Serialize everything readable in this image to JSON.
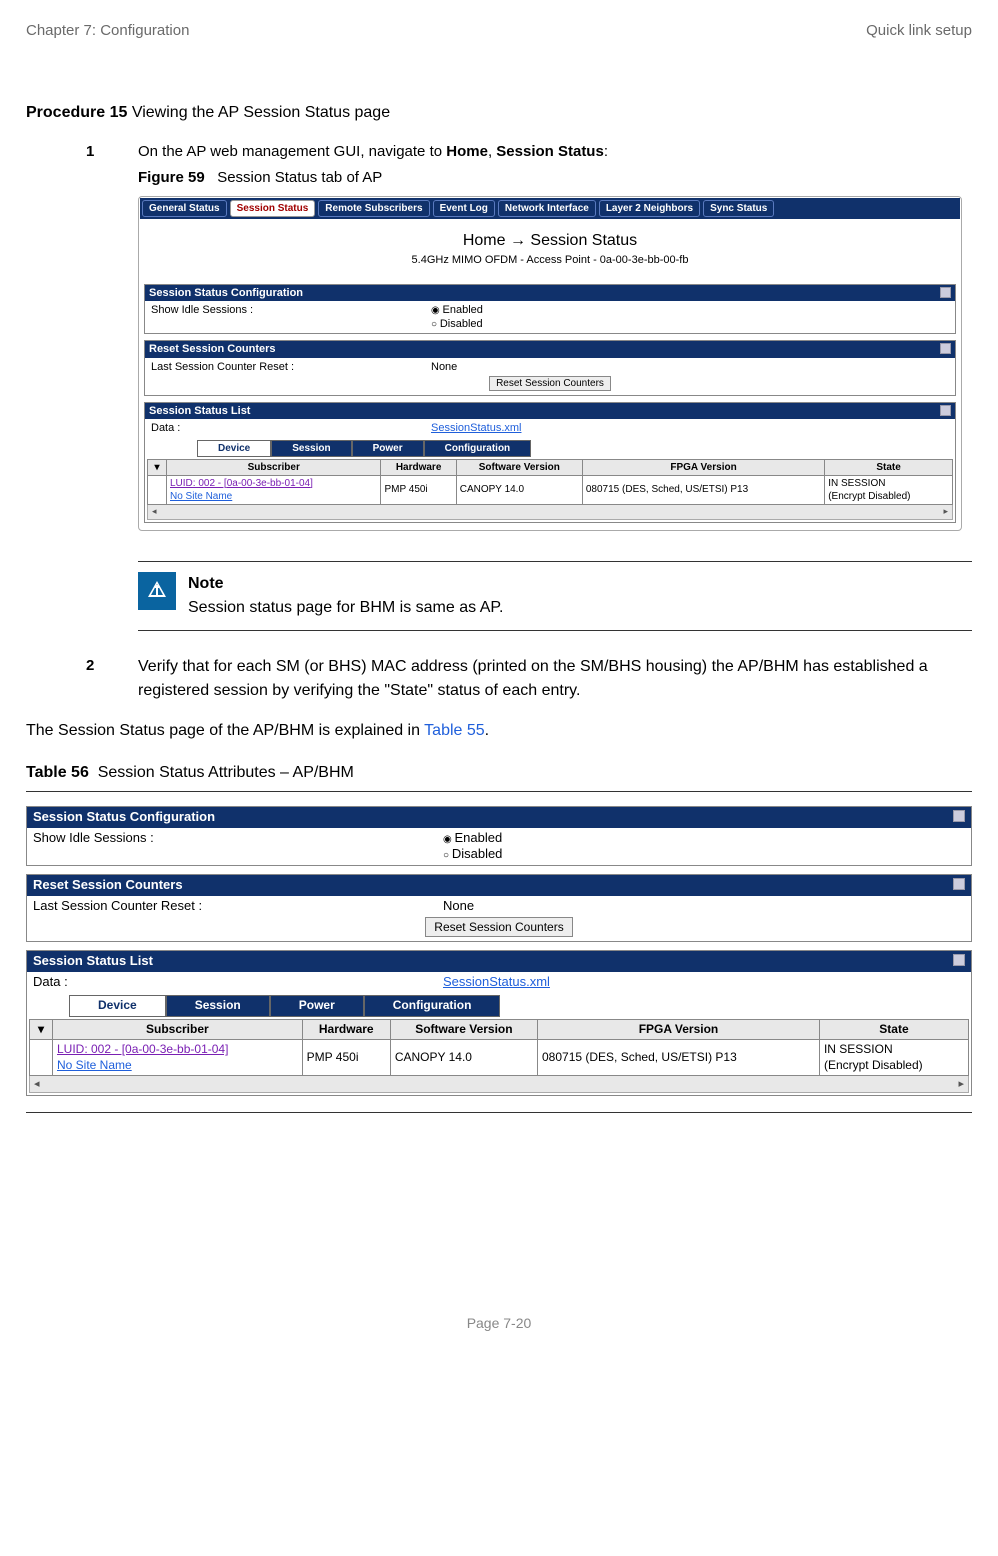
{
  "header": {
    "left": "Chapter 7:  Configuration",
    "right": "Quick link setup"
  },
  "procedure": {
    "num": "Procedure 15",
    "title": "Viewing the AP Session Status page"
  },
  "step1": {
    "num": "1",
    "text_a": "On the AP web management GUI, navigate to ",
    "home": "Home",
    "sep": ", ",
    "ss": "Session Status",
    "colon": ":"
  },
  "figure": {
    "num": "Figure 59",
    "caption": "Session Status tab of AP"
  },
  "tabs": [
    "General Status",
    "Session Status",
    "Remote Subscribers",
    "Event Log",
    "Network Interface",
    "Layer 2 Neighbors",
    "Sync Status"
  ],
  "breadcrumb": "Home → Session Status",
  "breadcrumb_sub": "5.4GHz MIMO OFDM - Access Point - 0a-00-3e-bb-00-fb",
  "sec_cfg": {
    "title": "Session Status Configuration",
    "row_label": "Show Idle Sessions :",
    "opt_en": "Enabled",
    "opt_dis": "Disabled"
  },
  "sec_reset": {
    "title": "Reset Session Counters",
    "row_label": "Last Session Counter Reset :",
    "row_val": "None",
    "btn": "Reset Session Counters"
  },
  "sec_list": {
    "title": "Session Status List",
    "data_label": "Data :",
    "data_link": "SessionStatus.xml"
  },
  "subtabs": [
    "Device",
    "Session",
    "Power",
    "Configuration"
  ],
  "grid_headers": [
    "Subscriber",
    "Hardware",
    "Software Version",
    "FPGA Version",
    "State"
  ],
  "grid_row": {
    "sub_line1": "LUID: 002 - [0a-00-3e-bb-01-04]",
    "sub_line2": "No Site Name",
    "hw": "PMP 450i",
    "sw": "CANOPY 14.0",
    "fpga": "080715 (DES, Sched, US/ETSI) P13",
    "state": "IN SESSION\n(Encrypt Disabled)"
  },
  "note": {
    "title": "Note",
    "body": "Session status page for BHM is same as AP."
  },
  "step2": {
    "num": "2",
    "text": "Verify that for each SM (or BHS) MAC address (printed on the SM/BHS housing) the AP/BHM has established a registered session by verifying the \"State\" status of each entry."
  },
  "para": {
    "a": "The Session Status page of the AP/BHM is explained in ",
    "link": "Table 55",
    "b": "."
  },
  "table56": {
    "num": "Table 56",
    "caption": "Session Status Attributes – AP/BHM"
  },
  "footer": "Page 7-20"
}
